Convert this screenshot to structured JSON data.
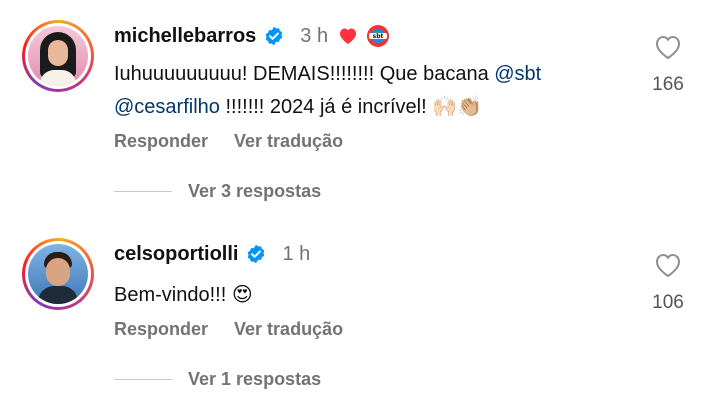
{
  "colors": {
    "mention": "#00376b",
    "muted": "#737373",
    "verified": "#0095f6",
    "heart_red": "#ff3040"
  },
  "comments": [
    {
      "username": "michellebarros",
      "time": "3 h",
      "text_before": "Iuhuuuuuuuuu! DEMAIS!!!!!!!! Que bacana ",
      "mention1": "@sbt",
      "mention2": "@cesarfilho",
      "text_after": " !!!!!!! 2024 já é incrível! ",
      "emoji": "🙌🏻👏🏼",
      "reply_label": "Responder",
      "translate_label": "Ver tradução",
      "view_replies": "Ver 3 respostas",
      "likes": "166"
    },
    {
      "username": "celsoportiolli",
      "time": "1 h",
      "text": "Bem-vindo!!! ",
      "emoji": "😍",
      "reply_label": "Responder",
      "translate_label": "Ver tradução",
      "view_replies": "Ver 1 respostas",
      "likes": "106"
    }
  ]
}
